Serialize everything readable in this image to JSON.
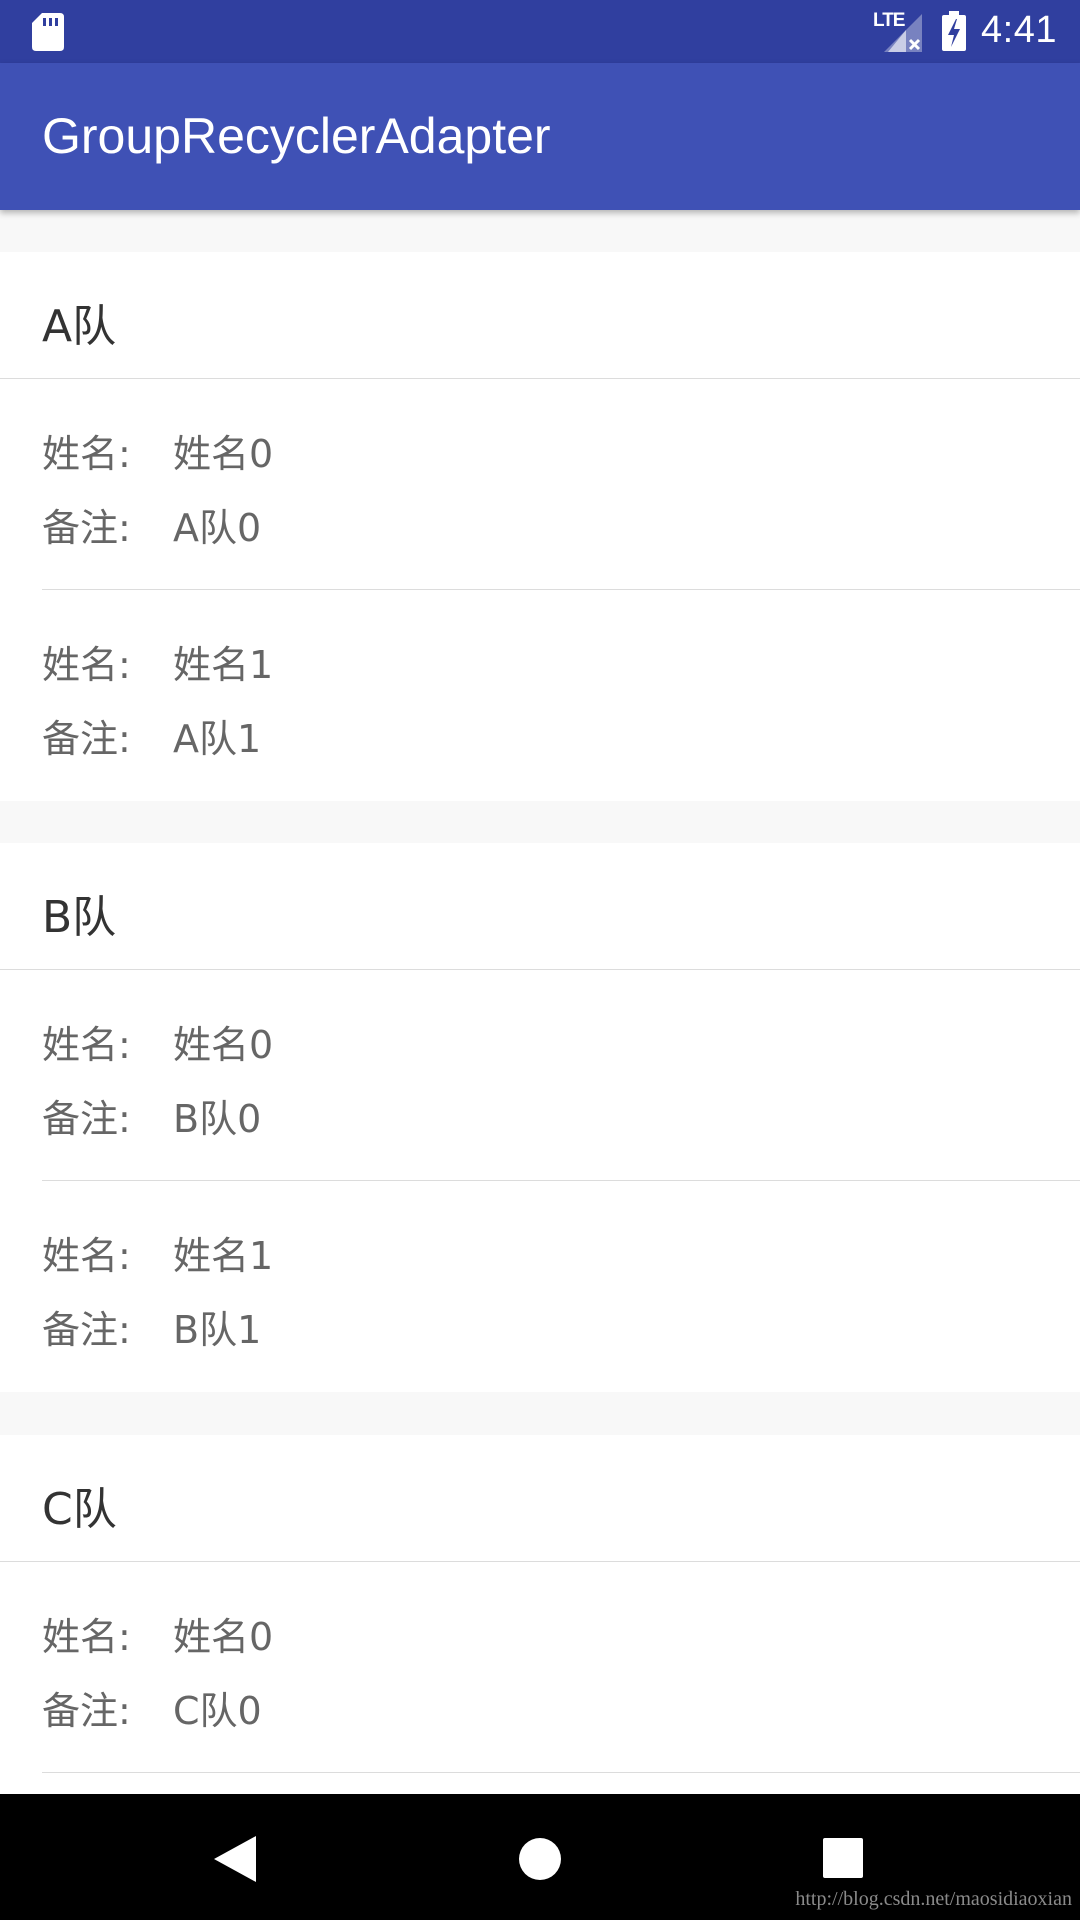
{
  "status_bar": {
    "network_label": "LTE",
    "time": "4:41"
  },
  "app_bar": {
    "title": "GroupRecyclerAdapter"
  },
  "groups": [
    {
      "header": "A队",
      "children": [
        {
          "name_label": "姓名:",
          "name": "姓名0",
          "note_label": "备注:",
          "note": "A队0"
        },
        {
          "name_label": "姓名:",
          "name": "姓名1",
          "note_label": "备注:",
          "note": "A队1"
        }
      ]
    },
    {
      "header": "B队",
      "children": [
        {
          "name_label": "姓名:",
          "name": "姓名0",
          "note_label": "备注:",
          "note": "B队0"
        },
        {
          "name_label": "姓名:",
          "name": "姓名1",
          "note_label": "备注:",
          "note": "B队1"
        }
      ]
    },
    {
      "header": "C队",
      "children": [
        {
          "name_label": "姓名:",
          "name": "姓名0",
          "note_label": "备注:",
          "note": "C队0"
        }
      ]
    }
  ],
  "watermark": "http://blog.csdn.net/maosidiaoxian",
  "colors": {
    "status_bar": "#303F9F",
    "app_bar": "#3F51B5",
    "header_text": "#333333",
    "child_text": "#666666",
    "list_background": "#F8F8F8",
    "nav_bar": "#000000"
  }
}
